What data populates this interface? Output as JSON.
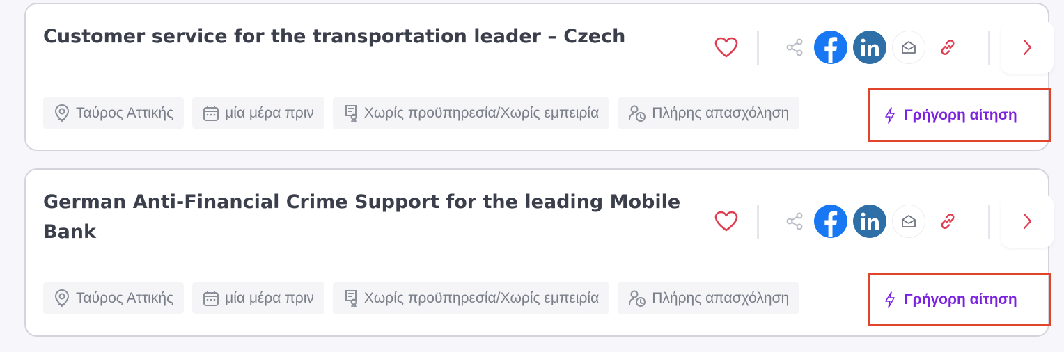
{
  "jobs": [
    {
      "title": "Customer service for the transportation leader – Czech",
      "location": "Ταύρος Αττικής",
      "posted": "μία μέρα πριν",
      "experience": "Χωρίς προϋπηρεσία/Χωρίς εμπειρία",
      "employment": "Πλήρης απασχόληση",
      "quick_apply": "Γρήγορη αίτηση"
    },
    {
      "title": "German Anti-Financial Crime Support for the leading Mobile Bank",
      "location": "Ταύρος Αττικής",
      "posted": "μία μέρα πριν",
      "experience": "Χωρίς προϋπηρεσία/Χωρίς εμπειρία",
      "employment": "Πλήρης απασχόληση",
      "quick_apply": "Γρήγορη αίτηση"
    }
  ],
  "icons": {
    "favorite": "heart-icon",
    "share": "share-icon",
    "facebook": "facebook-icon",
    "linkedin": "linkedin-icon",
    "email": "envelope-icon",
    "copy_link": "link-icon",
    "open": "chevron-right-icon",
    "location": "map-pin-icon",
    "date": "calendar-icon",
    "experience": "certificate-icon",
    "employment": "person-clock-icon",
    "quick_apply": "lightning-icon"
  },
  "colors": {
    "accent_purple": "#7b22e0",
    "heart_red": "#e03c4f",
    "facebook_blue": "#1877f2",
    "linkedin_blue": "#2e6fa8",
    "highlight_red": "#e0452c"
  }
}
